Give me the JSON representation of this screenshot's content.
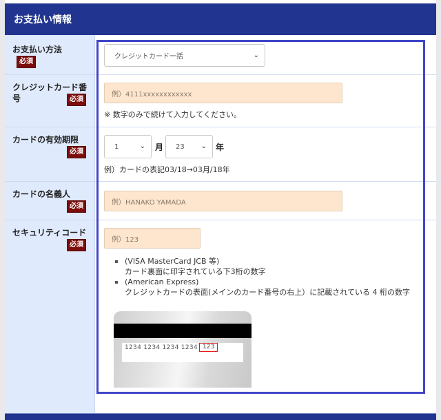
{
  "section": {
    "title": "お支払い情報"
  },
  "required_badge": "必須",
  "fields": {
    "payment_method": {
      "label": "お支払い方法",
      "selected": "クレジットカード一括"
    },
    "card_number": {
      "label_line1": "クレジットカード番",
      "label_line2": "号",
      "placeholder": "例）4111xxxxxxxxxxxx",
      "note": "※ 数字のみで続けて入力してください。"
    },
    "expiry": {
      "label": "カードの有効期限",
      "month_selected": "1",
      "month_unit": "月",
      "year_selected": "23",
      "year_unit": "年",
      "note": "例）カードの表記03/18→03月/18年"
    },
    "holder_name": {
      "label": "カードの名義人",
      "placeholder": "例）HANAKO YAMADA"
    },
    "security_code": {
      "label": "セキュリティコード",
      "placeholder": "例）123",
      "bullets": [
        {
          "title": "(VISA MasterCard JCB 等)",
          "desc": "カード裏面に印字されている下3桁の数字"
        },
        {
          "title": "(American Express)",
          "desc": "クレジットカードの表面(メインのカード番号の右上）に記載されている 4 桁の数字"
        }
      ],
      "card_image": {
        "numbers": "1234  1234  1234  1234",
        "cvv": "123"
      }
    }
  },
  "colors": {
    "header_bg": "#213590",
    "label_bg": "#dfeafc",
    "required_bg": "#7b0d0a",
    "input_bg": "#fde6cd",
    "highlight_border": "#4146c9",
    "cvv_box": "#e21b1b"
  }
}
